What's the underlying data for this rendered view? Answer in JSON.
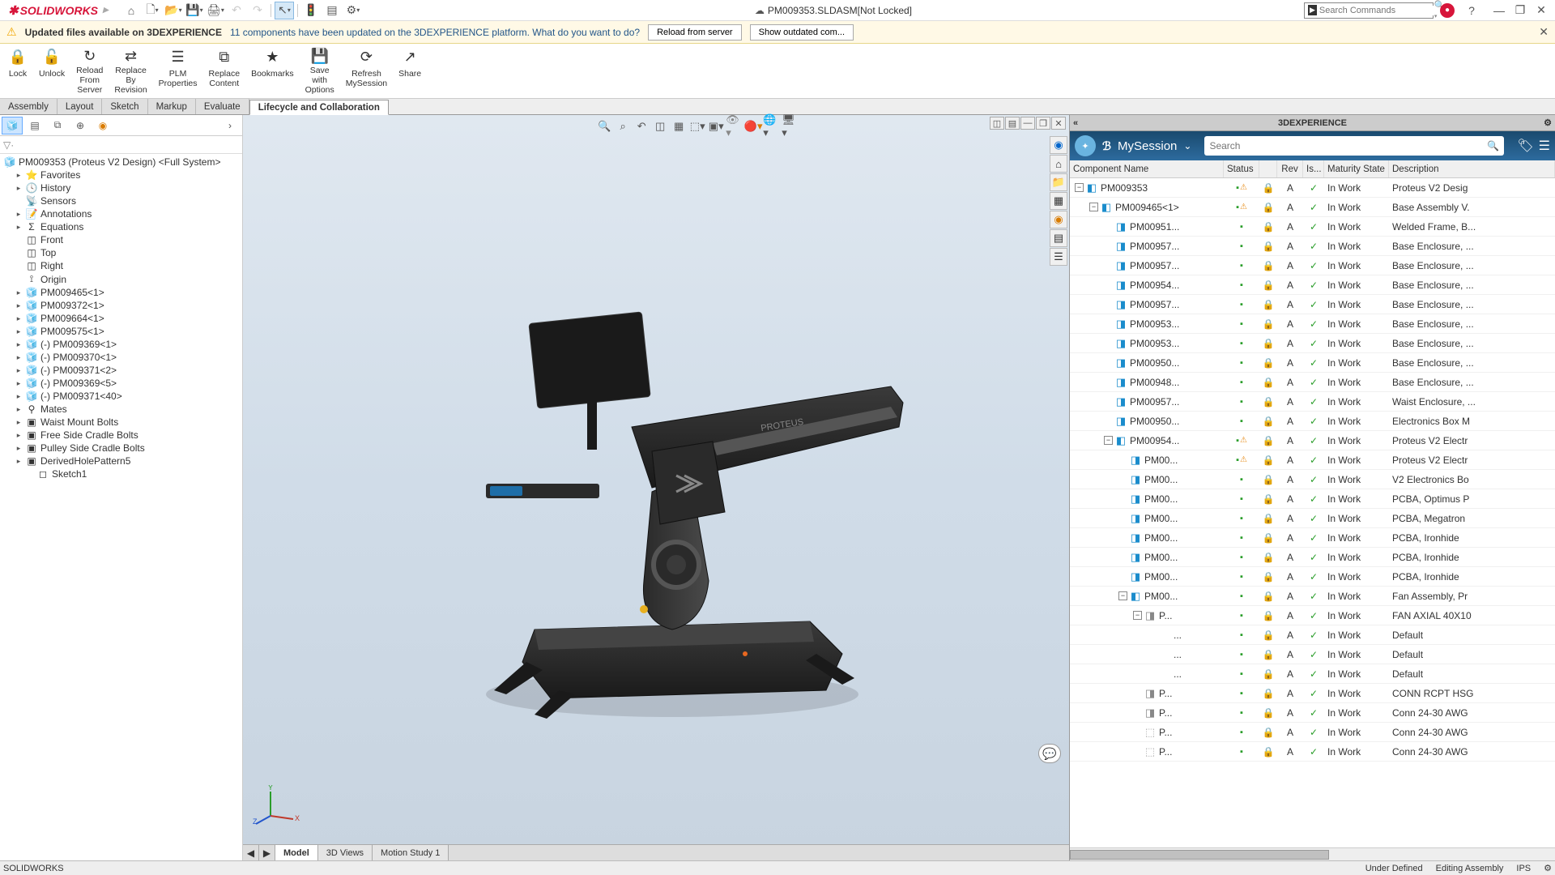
{
  "title": {
    "app": "SOLIDWORKS",
    "doc": "PM009353.SLDASM[Not Locked]"
  },
  "search_placeholder": "Search Commands",
  "notification": {
    "title": "Updated files available on 3DEXPERIENCE",
    "msg": "11 components have been updated on the 3DEXPERIENCE platform. What do you want to do?",
    "btn_reload": "Reload from server",
    "btn_show": "Show outdated com..."
  },
  "ribbon": [
    {
      "label": "Lock",
      "icon": "🔒"
    },
    {
      "label": "Unlock",
      "icon": "🔓"
    },
    {
      "label": "Reload\nFrom\nServer",
      "icon": "↻"
    },
    {
      "label": "Replace\nBy\nRevision",
      "icon": "⇄"
    },
    {
      "label": "PLM\nProperties",
      "icon": "☰"
    },
    {
      "label": "Replace\nContent",
      "icon": "⧉"
    },
    {
      "label": "Bookmarks",
      "icon": "★"
    },
    {
      "label": "Save\nwith\nOptions",
      "icon": "💾"
    },
    {
      "label": "Refresh\nMySession",
      "icon": "⟳"
    },
    {
      "label": "Share",
      "icon": "↗"
    }
  ],
  "tabs": [
    "Assembly",
    "Layout",
    "Sketch",
    "Markup",
    "Evaluate",
    "Lifecycle and Collaboration"
  ],
  "active_tab": 5,
  "tree_root": "PM009353 (Proteus V2 Design) <Full System>",
  "tree": [
    {
      "d": 1,
      "exp": "▸",
      "ic": "⭐",
      "label": "Favorites"
    },
    {
      "d": 1,
      "exp": "▸",
      "ic": "🕓",
      "label": "History"
    },
    {
      "d": 1,
      "exp": "",
      "ic": "📡",
      "label": "Sensors"
    },
    {
      "d": 1,
      "exp": "▸",
      "ic": "📝",
      "label": "Annotations"
    },
    {
      "d": 1,
      "exp": "▸",
      "ic": "Σ",
      "label": "Equations"
    },
    {
      "d": 1,
      "exp": "",
      "ic": "◫",
      "label": "Front"
    },
    {
      "d": 1,
      "exp": "",
      "ic": "◫",
      "label": "Top"
    },
    {
      "d": 1,
      "exp": "",
      "ic": "◫",
      "label": "Right"
    },
    {
      "d": 1,
      "exp": "",
      "ic": "⟟",
      "label": "Origin"
    },
    {
      "d": 1,
      "exp": "▸",
      "ic": "🧊",
      "label": "PM009465<1>"
    },
    {
      "d": 1,
      "exp": "▸",
      "ic": "🧊",
      "label": "PM009372<1>"
    },
    {
      "d": 1,
      "exp": "▸",
      "ic": "🧊",
      "label": "PM009664<1>"
    },
    {
      "d": 1,
      "exp": "▸",
      "ic": "🧊",
      "label": "PM009575<1>"
    },
    {
      "d": 1,
      "exp": "▸",
      "ic": "🧊",
      "label": "(-) PM009369<1>"
    },
    {
      "d": 1,
      "exp": "▸",
      "ic": "🧊",
      "label": "(-) PM009370<1>"
    },
    {
      "d": 1,
      "exp": "▸",
      "ic": "🧊",
      "label": "(-) PM009371<2>"
    },
    {
      "d": 1,
      "exp": "▸",
      "ic": "🧊",
      "label": "(-) PM009369<5>"
    },
    {
      "d": 1,
      "exp": "▸",
      "ic": "🧊",
      "label": "(-) PM009371<40>"
    },
    {
      "d": 1,
      "exp": "▸",
      "ic": "⚲",
      "label": "Mates"
    },
    {
      "d": 1,
      "exp": "▸",
      "ic": "▣",
      "label": "Waist Mount Bolts"
    },
    {
      "d": 1,
      "exp": "▸",
      "ic": "▣",
      "label": "Free Side Cradle Bolts"
    },
    {
      "d": 1,
      "exp": "▸",
      "ic": "▣",
      "label": "Pulley Side Cradle Bolts"
    },
    {
      "d": 1,
      "exp": "▸",
      "ic": "▣",
      "label": "DerivedHolePattern5"
    },
    {
      "d": 2,
      "exp": "",
      "ic": "◻",
      "label": "Sketch1"
    }
  ],
  "vp_bottom_tabs": [
    "Model",
    "3D Views",
    "Motion Study 1"
  ],
  "dx": {
    "panel_title": "3DEXPERIENCE",
    "session": "MySession",
    "search_placeholder": "Search",
    "columns": [
      "Component Name",
      "Status",
      "",
      "Rev",
      "Is...",
      "Maturity State",
      "Description"
    ],
    "rows": [
      {
        "d": 0,
        "exp": "-",
        "ic": "a",
        "name": "PM009353",
        "rev": "A",
        "mat": "In Work",
        "desc": "Proteus V2 Desig",
        "warn": true
      },
      {
        "d": 1,
        "exp": "-",
        "ic": "a",
        "name": "PM009465<1>",
        "rev": "A",
        "mat": "In Work",
        "desc": "Base Assembly V.",
        "warn": true
      },
      {
        "d": 2,
        "exp": "",
        "ic": "p",
        "name": "PM00951...",
        "rev": "A",
        "mat": "In Work",
        "desc": "Welded Frame, B..."
      },
      {
        "d": 2,
        "exp": "",
        "ic": "p",
        "name": "PM00957...",
        "rev": "A",
        "mat": "In Work",
        "desc": "Base Enclosure, ..."
      },
      {
        "d": 2,
        "exp": "",
        "ic": "p",
        "name": "PM00957...",
        "rev": "A",
        "mat": "In Work",
        "desc": "Base Enclosure, ..."
      },
      {
        "d": 2,
        "exp": "",
        "ic": "p",
        "name": "PM00954...",
        "rev": "A",
        "mat": "In Work",
        "desc": "Base Enclosure, ..."
      },
      {
        "d": 2,
        "exp": "",
        "ic": "p",
        "name": "PM00957...",
        "rev": "A",
        "mat": "In Work",
        "desc": "Base Enclosure, ..."
      },
      {
        "d": 2,
        "exp": "",
        "ic": "p",
        "name": "PM00953...",
        "rev": "A",
        "mat": "In Work",
        "desc": "Base Enclosure, ..."
      },
      {
        "d": 2,
        "exp": "",
        "ic": "p",
        "name": "PM00953...",
        "rev": "A",
        "mat": "In Work",
        "desc": "Base Enclosure, ..."
      },
      {
        "d": 2,
        "exp": "",
        "ic": "p",
        "name": "PM00950...",
        "rev": "A",
        "mat": "In Work",
        "desc": "Base Enclosure, ..."
      },
      {
        "d": 2,
        "exp": "",
        "ic": "p",
        "name": "PM00948...",
        "rev": "A",
        "mat": "In Work",
        "desc": "Base Enclosure, ..."
      },
      {
        "d": 2,
        "exp": "",
        "ic": "p",
        "name": "PM00957...",
        "rev": "A",
        "mat": "In Work",
        "desc": "Waist Enclosure, ..."
      },
      {
        "d": 2,
        "exp": "",
        "ic": "p",
        "name": "PM00950...",
        "rev": "A",
        "mat": "In Work",
        "desc": "Electronics Box M"
      },
      {
        "d": 2,
        "exp": "-",
        "ic": "a",
        "name": "PM00954...",
        "rev": "A",
        "mat": "In Work",
        "desc": "Proteus V2 Electr",
        "warn": true
      },
      {
        "d": 3,
        "exp": "",
        "ic": "p",
        "name": "PM00...",
        "rev": "A",
        "mat": "In Work",
        "desc": "Proteus V2 Electr",
        "warn": true
      },
      {
        "d": 3,
        "exp": "",
        "ic": "p",
        "name": "PM00...",
        "rev": "A",
        "mat": "In Work",
        "desc": "V2 Electronics Bo"
      },
      {
        "d": 3,
        "exp": "",
        "ic": "p",
        "name": "PM00...",
        "rev": "A",
        "mat": "In Work",
        "desc": "PCBA, Optimus P"
      },
      {
        "d": 3,
        "exp": "",
        "ic": "p",
        "name": "PM00...",
        "rev": "A",
        "mat": "In Work",
        "desc": "PCBA, Megatron"
      },
      {
        "d": 3,
        "exp": "",
        "ic": "p",
        "name": "PM00...",
        "rev": "A",
        "mat": "In Work",
        "desc": "PCBA, Ironhide"
      },
      {
        "d": 3,
        "exp": "",
        "ic": "p",
        "name": "PM00...",
        "rev": "A",
        "mat": "In Work",
        "desc": "PCBA, Ironhide"
      },
      {
        "d": 3,
        "exp": "",
        "ic": "p",
        "name": "PM00...",
        "rev": "A",
        "mat": "In Work",
        "desc": "PCBA, Ironhide"
      },
      {
        "d": 3,
        "exp": "-",
        "ic": "a",
        "name": "PM00...",
        "rev": "A",
        "mat": "In Work",
        "desc": "Fan Assembly, Pr"
      },
      {
        "d": 4,
        "exp": "-",
        "ic": "p2",
        "name": "P...",
        "rev": "A",
        "mat": "In Work",
        "desc": "FAN AXIAL 40X10"
      },
      {
        "d": 5,
        "exp": "",
        "ic": "",
        "name": "...",
        "rev": "A",
        "mat": "In Work",
        "desc": "Default"
      },
      {
        "d": 5,
        "exp": "",
        "ic": "",
        "name": "...",
        "rev": "A",
        "mat": "In Work",
        "desc": "Default"
      },
      {
        "d": 5,
        "exp": "",
        "ic": "",
        "name": "...",
        "rev": "A",
        "mat": "In Work",
        "desc": "Default"
      },
      {
        "d": 4,
        "exp": "",
        "ic": "p2",
        "name": "P...",
        "rev": "A",
        "mat": "In Work",
        "desc": "CONN RCPT HSG"
      },
      {
        "d": 4,
        "exp": "",
        "ic": "p2",
        "name": "P...",
        "rev": "A",
        "mat": "In Work",
        "desc": "Conn 24-30 AWG"
      },
      {
        "d": 4,
        "exp": "",
        "ic": "p3",
        "name": "P...",
        "rev": "A",
        "mat": "In Work",
        "desc": "Conn 24-30 AWG"
      },
      {
        "d": 4,
        "exp": "",
        "ic": "p3",
        "name": "P...",
        "rev": "A",
        "mat": "In Work",
        "desc": "Conn 24-30 AWG"
      }
    ]
  },
  "status": {
    "app": "SOLIDWORKS",
    "ud": "Under Defined",
    "mode": "Editing Assembly",
    "units": "IPS"
  }
}
